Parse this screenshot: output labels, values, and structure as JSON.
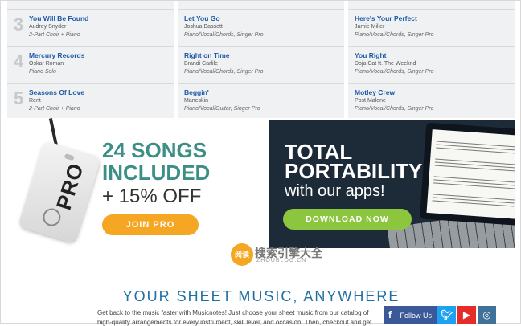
{
  "chart_list": {
    "columns": [
      {
        "entries": [
          {
            "rank": "3",
            "title": "You Will Be Found",
            "artist": "Audrey Snyder",
            "arrangement": "2-Part Choir + Piano"
          },
          {
            "rank": "4",
            "title": "Mercury Records",
            "artist": "Oskar Roman",
            "arrangement": "Piano Solo"
          },
          {
            "rank": "5",
            "title": "Seasons Of Love",
            "artist": "Rent",
            "arrangement": "2-Part Choir + Piano"
          }
        ]
      },
      {
        "entries": [
          {
            "title": "Let You Go",
            "artist": "Joshua Bassett",
            "arrangement": "Piano/Vocal/Chords, Singer Pro"
          },
          {
            "title": "Right on Time",
            "artist": "Brandi Carlile",
            "arrangement": "Piano/Vocal/Chords, Singer Pro"
          },
          {
            "title": "Beggin'",
            "artist": "Maneskin",
            "arrangement": "Piano/Vocal/Guitar, Singer Pro"
          }
        ]
      },
      {
        "entries": [
          {
            "title": "Here's Your Perfect",
            "artist": "Jamie Miller",
            "arrangement": "Piano/Vocal/Chords, Singer Pro"
          },
          {
            "title": "You Right",
            "artist": "Doja Cat ft. The Weeknd",
            "arrangement": "Piano/Vocal/Chords, Singer Pro"
          },
          {
            "title": "Motley Crew",
            "artist": "Post Malone",
            "arrangement": "Piano/Vocal/Chords, Singer Pro"
          }
        ]
      }
    ]
  },
  "promo_pro": {
    "tag_label": "PRO",
    "headline_line1": "24 SONGS",
    "headline_line2": "INCLUDED",
    "offer": "+ 15% OFF",
    "button": "JOIN PRO"
  },
  "promo_apps": {
    "headline_line1": "TOTAL",
    "headline_line2": "PORTABILITY",
    "subline": "with our apps!",
    "button": "DOWNLOAD NOW"
  },
  "watermark": {
    "badge": "阅读",
    "text": "搜索引擎大全",
    "sub": "ZHOUBLOG.CN"
  },
  "section": {
    "title": "YOUR SHEET MUSIC, ANYWHERE",
    "desc_line1": "Get back to the music faster with Musicnotes! Just choose your sheet music from our catalog of",
    "desc_line2": "high-quality arrangements for every instrument, skill level, and occasion. Then, checkout and get"
  },
  "social": {
    "facebook_label": "Follow Us",
    "colors": {
      "facebook": "#3b5998",
      "twitter": "#1da1f2",
      "youtube": "#e52d27",
      "instagram": "#3f729b"
    }
  }
}
